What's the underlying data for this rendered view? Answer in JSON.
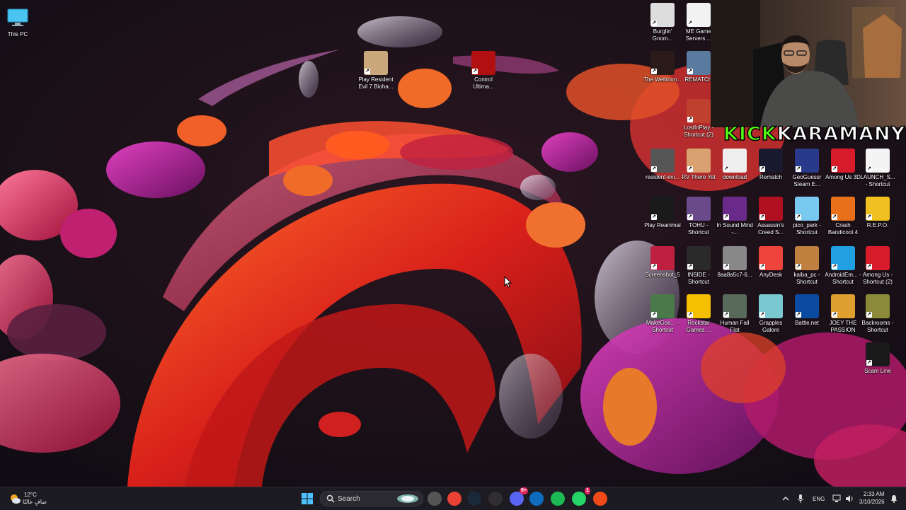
{
  "desktop": {
    "this_pc": {
      "label": "This PC",
      "icon": "monitor-icon"
    },
    "center_icons": [
      {
        "label": "Play Resident Evil 7 Bioha...",
        "icon": "resident-evil-7-icon",
        "color": "#c9a77a"
      },
      {
        "label": "Control Ultima...",
        "icon": "control-game-icon",
        "color": "#b01010"
      }
    ],
    "right_icons": [
      {
        "label": "Burglin' Gnom...",
        "icon": "burglin-gnomes-icon",
        "color": "#ddd"
      },
      {
        "label": "ME Game Servers ...",
        "icon": "me-game-servers-icon",
        "color": "#f2f2f2"
      },
      {
        "label": "The Wellmon...",
        "icon": "wellmonster-icon",
        "color": "#2a1a1a"
      },
      {
        "label": "REMATCH",
        "icon": "rematch-icon",
        "color": "#5a7aa0"
      },
      {
        "label": "LostInPlay - Shortcut (2)",
        "icon": "lost-in-play-icon",
        "color": "#c04030"
      },
      {
        "label": "resident-evi...",
        "icon": "resident-evil-thumb-icon",
        "color": "#555"
      },
      {
        "label": "RV There Yet",
        "icon": "rv-there-yet-icon",
        "color": "#d9a070"
      },
      {
        "label": "download",
        "icon": "download-image-icon",
        "color": "#eee"
      },
      {
        "label": "Rematch",
        "icon": "rematch-dark-icon",
        "color": "#1a1a2e"
      },
      {
        "label": "GeoGuessr Steam E...",
        "icon": "geoguessr-icon",
        "color": "#2a3a8a"
      },
      {
        "label": "Among Us 3D",
        "icon": "among-us-3d-icon",
        "color": "#d81b2a"
      },
      {
        "label": "LAUNCH_S... - Shortcut",
        "icon": "launch-settings-icon",
        "color": "#f4f4f4"
      },
      {
        "label": "Play Reanimal",
        "icon": "reanimal-icon",
        "color": "#1a1a1a"
      },
      {
        "label": "TOHU - Shortcut",
        "icon": "tohu-icon",
        "color": "#6a4a8a"
      },
      {
        "label": "In Sound Mind -...",
        "icon": "in-sound-mind-icon",
        "color": "#6a2a8a"
      },
      {
        "label": "Assassin's Creed S...",
        "icon": "assassins-creed-icon",
        "color": "#b01020"
      },
      {
        "label": "pico_park - Shortcut",
        "icon": "pico-park-icon",
        "color": "#78c8f0"
      },
      {
        "label": "Crash Bandicoot 4",
        "icon": "crash-bandicoot-icon",
        "color": "#e8701a"
      },
      {
        "label": "R.E.P.O.",
        "icon": "repo-icon",
        "color": "#f0c020"
      },
      {
        "label": "Screenshot_5",
        "icon": "screenshot-icon",
        "color": "#c02040"
      },
      {
        "label": "INSIDE - Shortcut",
        "icon": "inside-icon",
        "color": "#2a2a2a"
      },
      {
        "label": "8aa8a5c7-6...",
        "icon": "image-file-icon",
        "color": "#888"
      },
      {
        "label": "AnyDesk",
        "icon": "anydesk-icon",
        "color": "#ef443b"
      },
      {
        "label": "kaiba_pc - Shortcut",
        "icon": "kaiba-pc-icon",
        "color": "#c08040"
      },
      {
        "label": "AndroidEm... - Shortcut",
        "icon": "android-emulator-icon",
        "color": "#20a0e0"
      },
      {
        "label": "Among Us - Shortcut (2)",
        "icon": "among-us-icon",
        "color": "#d81b2a"
      },
      {
        "label": "MakeGoo... - Shortcut",
        "icon": "make-goose-icon",
        "color": "#4a7a4a"
      },
      {
        "label": "Rockstar Games ...",
        "icon": "rockstar-games-icon",
        "color": "#f5c000"
      },
      {
        "label": "Human Fall Flat",
        "icon": "human-fall-flat-icon",
        "color": "#5a6a5a"
      },
      {
        "label": "Grapples Galore",
        "icon": "grapples-galore-icon",
        "color": "#7ac8d0"
      },
      {
        "label": "Battle.net",
        "icon": "battlenet-icon",
        "color": "#0a4aa0"
      },
      {
        "label": "JOEY THE PASSION",
        "icon": "joey-the-passion-icon",
        "color": "#e0a030"
      },
      {
        "label": "Backrooms - Shortcut",
        "icon": "backrooms-icon",
        "color": "#8a8a3a"
      },
      {
        "label": "Scam Line",
        "icon": "scam-line-icon",
        "color": "#1a1a1a"
      }
    ]
  },
  "overlay": {
    "kick": "KICK",
    "name": "KARAMANY",
    "webcam": "webcam-feed"
  },
  "taskbar": {
    "weather": {
      "temp": "12°C",
      "desc": "صافٍ غالبًا",
      "icon": "weather-sun-cloud-icon"
    },
    "start_icon": "windows-start-icon",
    "search": {
      "placeholder": "Search",
      "icon": "search-icon"
    },
    "apps": [
      {
        "name": "task-view-icon",
        "color": "#555"
      },
      {
        "name": "chrome-icon",
        "color": "#e94235"
      },
      {
        "name": "steam-icon",
        "color": "#1b2838"
      },
      {
        "name": "obs-icon",
        "color": "#302e31"
      },
      {
        "name": "discord-icon",
        "color": "#5865f2",
        "badge": "9+"
      },
      {
        "name": "outlook-icon",
        "color": "#0f6cbd"
      },
      {
        "name": "spotify-icon",
        "color": "#1db954"
      },
      {
        "name": "whatsapp-icon",
        "color": "#25d366",
        "badge": "1"
      },
      {
        "name": "ea-app-icon",
        "color": "#f04a1a"
      }
    ],
    "tray": {
      "lang": "ENG",
      "time": "2:33 AM",
      "date": "3/10/2026"
    }
  }
}
